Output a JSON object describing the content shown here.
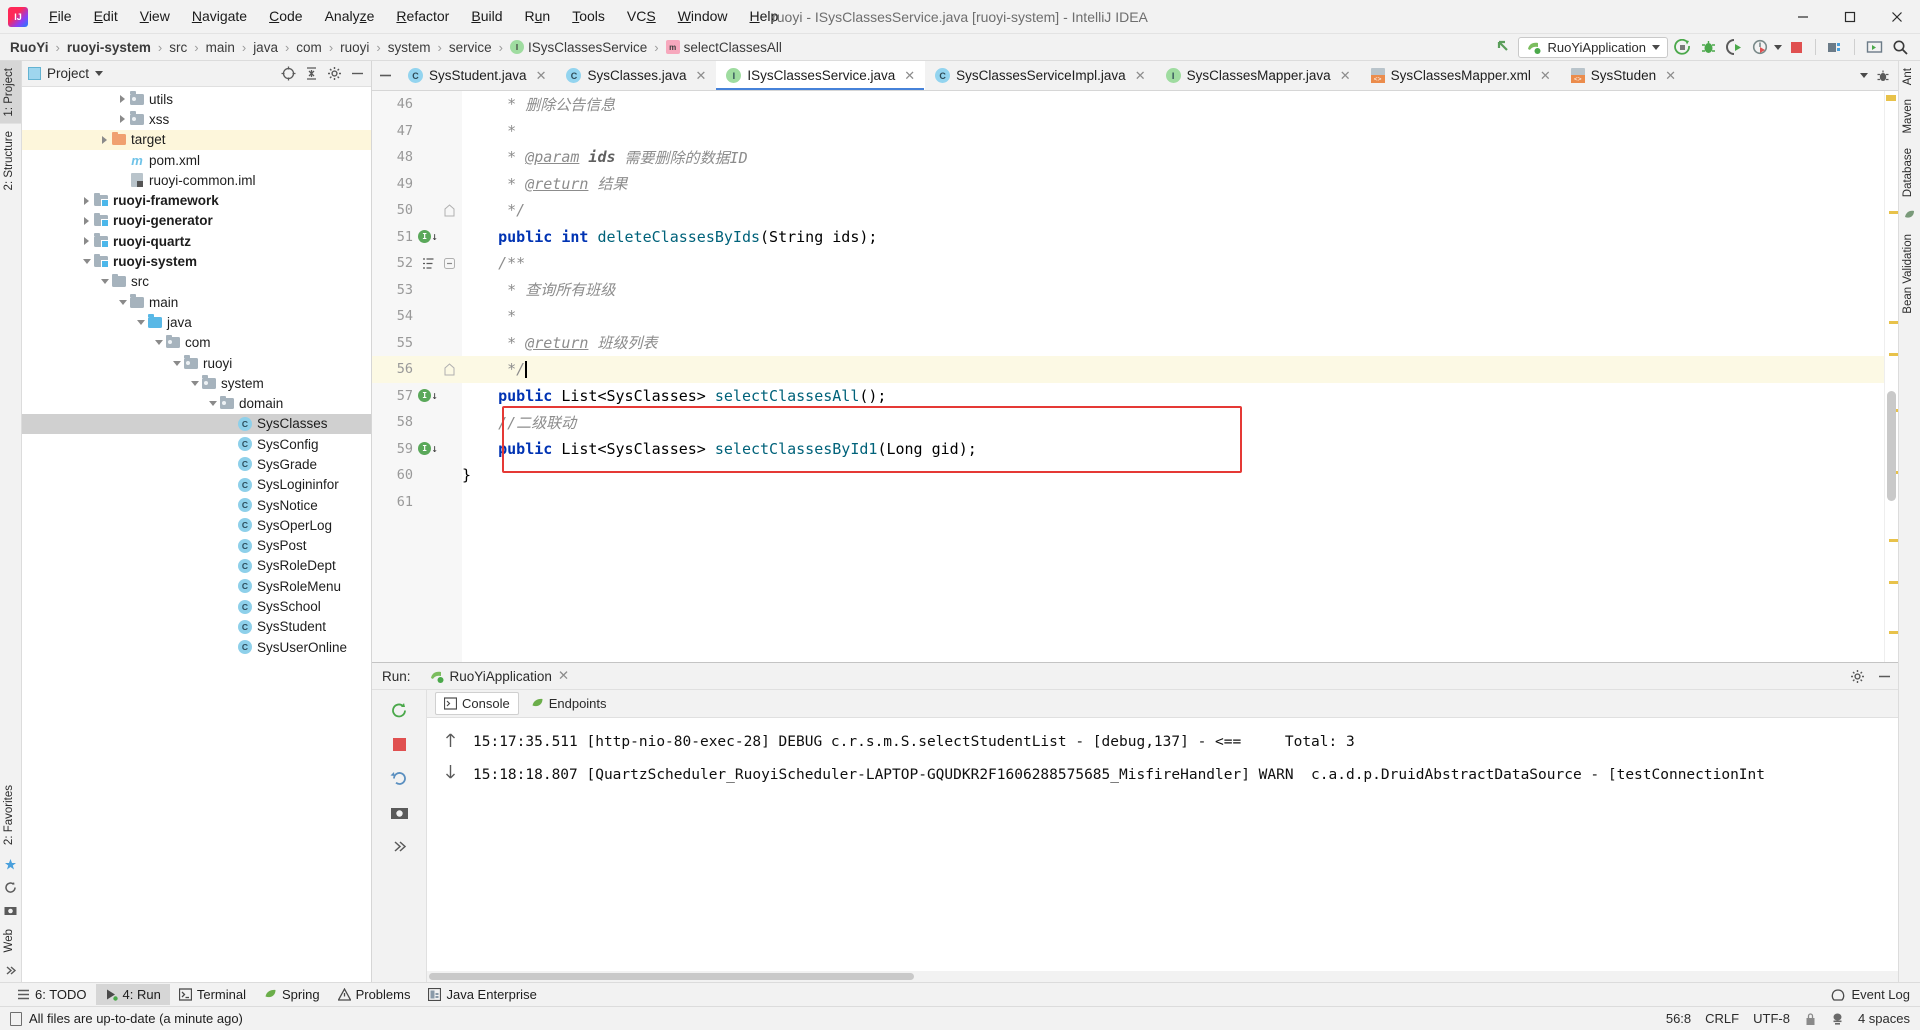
{
  "window": {
    "title": "ruoyi - ISysClassesService.java [ruoyi-system] - IntelliJ IDEA",
    "logo_text": "IJ",
    "minimize": "—",
    "maximize": "❐",
    "close": "✕"
  },
  "menu": [
    {
      "label": "File"
    },
    {
      "label": "Edit"
    },
    {
      "label": "View"
    },
    {
      "label": "Navigate"
    },
    {
      "label": "Code"
    },
    {
      "label": "Analyze"
    },
    {
      "label": "Refactor"
    },
    {
      "label": "Build"
    },
    {
      "label": "Run"
    },
    {
      "label": "Tools"
    },
    {
      "label": "VCS"
    },
    {
      "label": "Window"
    },
    {
      "label": "Help"
    }
  ],
  "breadcrumb": [
    {
      "label": "RuoYi",
      "bold": true,
      "icon": ""
    },
    {
      "label": "ruoyi-system",
      "bold": true,
      "icon": ""
    },
    {
      "label": "src",
      "bold": false,
      "icon": ""
    },
    {
      "label": "main",
      "bold": false,
      "icon": ""
    },
    {
      "label": "java",
      "bold": false,
      "icon": ""
    },
    {
      "label": "com",
      "bold": false,
      "icon": ""
    },
    {
      "label": "ruoyi",
      "bold": false,
      "icon": ""
    },
    {
      "label": "system",
      "bold": false,
      "icon": ""
    },
    {
      "label": "service",
      "bold": false,
      "icon": ""
    },
    {
      "label": "ISysClassesService",
      "bold": false,
      "icon": "I"
    },
    {
      "label": "selectClassesAll",
      "bold": false,
      "icon": "m"
    }
  ],
  "toolbar": {
    "run_config": "RuoYiApplication",
    "icons": [
      {
        "name": "run-icon"
      },
      {
        "name": "debug-icon"
      },
      {
        "name": "run-with-coverage-icon"
      },
      {
        "name": "profiler-icon"
      },
      {
        "name": "stop-icon"
      },
      {
        "name": "project-structure-icon"
      },
      {
        "name": "updates-icon"
      },
      {
        "name": "search-everywhere-icon"
      }
    ]
  },
  "left_rail": [
    "1: Project",
    "2: Structure"
  ],
  "left_rail_bottom": [
    "2: Favorites",
    "Web"
  ],
  "right_rail": [
    "Ant",
    "Maven",
    "Database",
    "Bean Validation"
  ],
  "project": {
    "title": "Project",
    "tree": [
      {
        "label": "utils",
        "depth": 5,
        "arrow": "right",
        "icon": "pkg",
        "bold": false
      },
      {
        "label": "xss",
        "depth": 5,
        "arrow": "right",
        "icon": "pkg",
        "bold": false
      },
      {
        "label": "target",
        "depth": 4,
        "arrow": "right",
        "icon": "orange",
        "bold": false,
        "state": "hl"
      },
      {
        "label": "pom.xml",
        "depth": 5,
        "arrow": "none",
        "icon": "maven",
        "bold": false
      },
      {
        "label": "ruoyi-common.iml",
        "depth": 5,
        "arrow": "none",
        "icon": "iml",
        "bold": false
      },
      {
        "label": "ruoyi-framework",
        "depth": 3,
        "arrow": "right",
        "icon": "module",
        "bold": true
      },
      {
        "label": "ruoyi-generator",
        "depth": 3,
        "arrow": "right",
        "icon": "module",
        "bold": true
      },
      {
        "label": "ruoyi-quartz",
        "depth": 3,
        "arrow": "right",
        "icon": "module",
        "bold": true
      },
      {
        "label": "ruoyi-system",
        "depth": 3,
        "arrow": "down",
        "icon": "module",
        "bold": true
      },
      {
        "label": "src",
        "depth": 4,
        "arrow": "down",
        "icon": "gray",
        "bold": false
      },
      {
        "label": "main",
        "depth": 5,
        "arrow": "down",
        "icon": "gray",
        "bold": false
      },
      {
        "label": "java",
        "depth": 6,
        "arrow": "down",
        "icon": "blue",
        "bold": false
      },
      {
        "label": "com",
        "depth": 7,
        "arrow": "down",
        "icon": "pkg",
        "bold": false
      },
      {
        "label": "ruoyi",
        "depth": 8,
        "arrow": "down",
        "icon": "pkg",
        "bold": false
      },
      {
        "label": "system",
        "depth": 9,
        "arrow": "down",
        "icon": "pkg",
        "bold": false
      },
      {
        "label": "domain",
        "depth": 10,
        "arrow": "down",
        "icon": "pkg",
        "bold": false
      },
      {
        "label": "SysClasses",
        "depth": 11,
        "arrow": "none",
        "icon": "class",
        "bold": false,
        "state": "sel"
      },
      {
        "label": "SysConfig",
        "depth": 11,
        "arrow": "none",
        "icon": "class",
        "bold": false
      },
      {
        "label": "SysGrade",
        "depth": 11,
        "arrow": "none",
        "icon": "class",
        "bold": false
      },
      {
        "label": "SysLogininfor",
        "depth": 11,
        "arrow": "none",
        "icon": "class",
        "bold": false
      },
      {
        "label": "SysNotice",
        "depth": 11,
        "arrow": "none",
        "icon": "class",
        "bold": false
      },
      {
        "label": "SysOperLog",
        "depth": 11,
        "arrow": "none",
        "icon": "class",
        "bold": false
      },
      {
        "label": "SysPost",
        "depth": 11,
        "arrow": "none",
        "icon": "class",
        "bold": false
      },
      {
        "label": "SysRoleDept",
        "depth": 11,
        "arrow": "none",
        "icon": "class",
        "bold": false
      },
      {
        "label": "SysRoleMenu",
        "depth": 11,
        "arrow": "none",
        "icon": "class",
        "bold": false
      },
      {
        "label": "SysSchool",
        "depth": 11,
        "arrow": "none",
        "icon": "class",
        "bold": false
      },
      {
        "label": "SysStudent",
        "depth": 11,
        "arrow": "none",
        "icon": "class",
        "bold": false
      },
      {
        "label": "SysUserOnline",
        "depth": 11,
        "arrow": "none",
        "icon": "class",
        "bold": false
      }
    ]
  },
  "editor": {
    "tabs": [
      {
        "label": "SysStudent.java",
        "icon": "C",
        "active": false
      },
      {
        "label": "SysClasses.java",
        "icon": "C",
        "active": false
      },
      {
        "label": "ISysClassesService.java",
        "icon": "I",
        "active": true
      },
      {
        "label": "SysClassesServiceImpl.java",
        "icon": "C",
        "active": false
      },
      {
        "label": "SysClassesMapper.java",
        "icon": "I",
        "active": false
      },
      {
        "label": "SysClassesMapper.xml",
        "icon": "XML",
        "active": false
      },
      {
        "label": "SysStuden",
        "icon": "XML",
        "active": false
      }
    ],
    "lines": [
      {
        "num": "46",
        "mark": "",
        "fold": "",
        "hl": false,
        "tokens": [
          {
            "t": "cm",
            "v": "     * "
          },
          {
            "t": "cm",
            "v": "删除公告信息"
          }
        ]
      },
      {
        "num": "47",
        "mark": "",
        "fold": "",
        "hl": false,
        "tokens": [
          {
            "t": "cm",
            "v": "     *"
          }
        ]
      },
      {
        "num": "48",
        "mark": "",
        "fold": "",
        "hl": false,
        "tokens": [
          {
            "t": "cm",
            "v": "     * "
          },
          {
            "t": "tag",
            "v": "@param"
          },
          {
            "t": "cmb",
            "v": " ids"
          },
          {
            "t": "cm",
            "v": " 需要删除的数据ID"
          }
        ]
      },
      {
        "num": "49",
        "mark": "",
        "fold": "",
        "hl": false,
        "tokens": [
          {
            "t": "cm",
            "v": "     * "
          },
          {
            "t": "tag",
            "v": "@return"
          },
          {
            "t": "cm",
            "v": " 结果"
          }
        ]
      },
      {
        "num": "50",
        "mark": "",
        "fold": "end",
        "hl": false,
        "tokens": [
          {
            "t": "cm",
            "v": "     */"
          }
        ]
      },
      {
        "num": "51",
        "mark": "impl",
        "fold": "",
        "hl": false,
        "tokens": [
          {
            "t": "pl",
            "v": "    "
          },
          {
            "t": "kw",
            "v": "public"
          },
          {
            "t": "pl",
            "v": " "
          },
          {
            "t": "kw",
            "v": "int"
          },
          {
            "t": "pl",
            "v": " "
          },
          {
            "t": "fn",
            "v": "deleteClassesByIds"
          },
          {
            "t": "pl",
            "v": "(String ids);"
          }
        ]
      },
      {
        "num": "52",
        "mark": "doc",
        "fold": "start",
        "hl": false,
        "tokens": [
          {
            "t": "cm",
            "v": "    /**"
          }
        ]
      },
      {
        "num": "53",
        "mark": "",
        "fold": "",
        "hl": false,
        "tokens": [
          {
            "t": "cm",
            "v": "     * 查询所有班级"
          }
        ]
      },
      {
        "num": "54",
        "mark": "",
        "fold": "",
        "hl": false,
        "tokens": [
          {
            "t": "cm",
            "v": "     *"
          }
        ]
      },
      {
        "num": "55",
        "mark": "",
        "fold": "",
        "hl": false,
        "tokens": [
          {
            "t": "cm",
            "v": "     * "
          },
          {
            "t": "tag",
            "v": "@return"
          },
          {
            "t": "cm",
            "v": " 班级列表"
          }
        ]
      },
      {
        "num": "56",
        "mark": "",
        "fold": "end",
        "hl": true,
        "tokens": [
          {
            "t": "cm",
            "v": "     */"
          },
          {
            "t": "caret",
            "v": ""
          }
        ]
      },
      {
        "num": "57",
        "mark": "impl",
        "fold": "",
        "hl": false,
        "tokens": [
          {
            "t": "pl",
            "v": "    "
          },
          {
            "t": "kw",
            "v": "public"
          },
          {
            "t": "pl",
            "v": " List<SysClasses> "
          },
          {
            "t": "fn",
            "v": "selectClassesAll"
          },
          {
            "t": "pl",
            "v": "();"
          }
        ]
      },
      {
        "num": "58",
        "mark": "",
        "fold": "",
        "hl": false,
        "tokens": [
          {
            "t": "cm",
            "v": "    //二级联动"
          }
        ]
      },
      {
        "num": "59",
        "mark": "impl",
        "fold": "",
        "hl": false,
        "tokens": [
          {
            "t": "pl",
            "v": "    "
          },
          {
            "t": "kw",
            "v": "public"
          },
          {
            "t": "pl",
            "v": " List<SysClasses> "
          },
          {
            "t": "fn",
            "v": "selectClassesById1"
          },
          {
            "t": "pl",
            "v": "(Long gid);"
          }
        ]
      },
      {
        "num": "60",
        "mark": "",
        "fold": "",
        "hl": false,
        "tokens": [
          {
            "t": "pl",
            "v": "}"
          }
        ]
      },
      {
        "num": "61",
        "mark": "",
        "fold": "",
        "hl": false,
        "tokens": []
      }
    ]
  },
  "run_window": {
    "label": "Run:",
    "config_tab": "RuoYiApplication",
    "close_x": "✕",
    "settings_icon": "gear-icon",
    "hide_icon": "minimize-icon",
    "console_tabs": [
      {
        "label": "Console",
        "active": true
      },
      {
        "label": "Endpoints",
        "active": false
      }
    ],
    "log_lines": [
      "15:17:35.511 [http-nio-80-exec-28] DEBUG c.r.s.m.S.selectStudentList - [debug,137] - <==     Total: 3",
      "15:18:18.807 [QuartzScheduler_RuoyiScheduler-LAPTOP-GQUDKR2F1606288575685_MisfireHandler] WARN  c.a.d.p.DruidAbstractDataSource - [testConnectionInt"
    ]
  },
  "bottom_bar": {
    "items": [
      {
        "label": "6: TODO",
        "icon": "todo-icon",
        "active": false
      },
      {
        "label": "4: Run",
        "icon": "run-icon",
        "active": true
      },
      {
        "label": "Terminal",
        "icon": "terminal-icon",
        "active": false
      },
      {
        "label": "Spring",
        "icon": "spring-icon",
        "active": false
      },
      {
        "label": "Problems",
        "icon": "problems-icon",
        "active": false
      },
      {
        "label": "Java Enterprise",
        "icon": "java-ee-icon",
        "active": false
      }
    ],
    "event_log": "Event Log"
  },
  "status_bar": {
    "message": "All files are up-to-date (a minute ago)",
    "caret_position": "56:8",
    "line_separator": "CRLF",
    "encoding": "UTF-8",
    "indent": "4 spaces",
    "lock_icon": "lock-icon",
    "inspection_icon": "inspection-icon"
  }
}
